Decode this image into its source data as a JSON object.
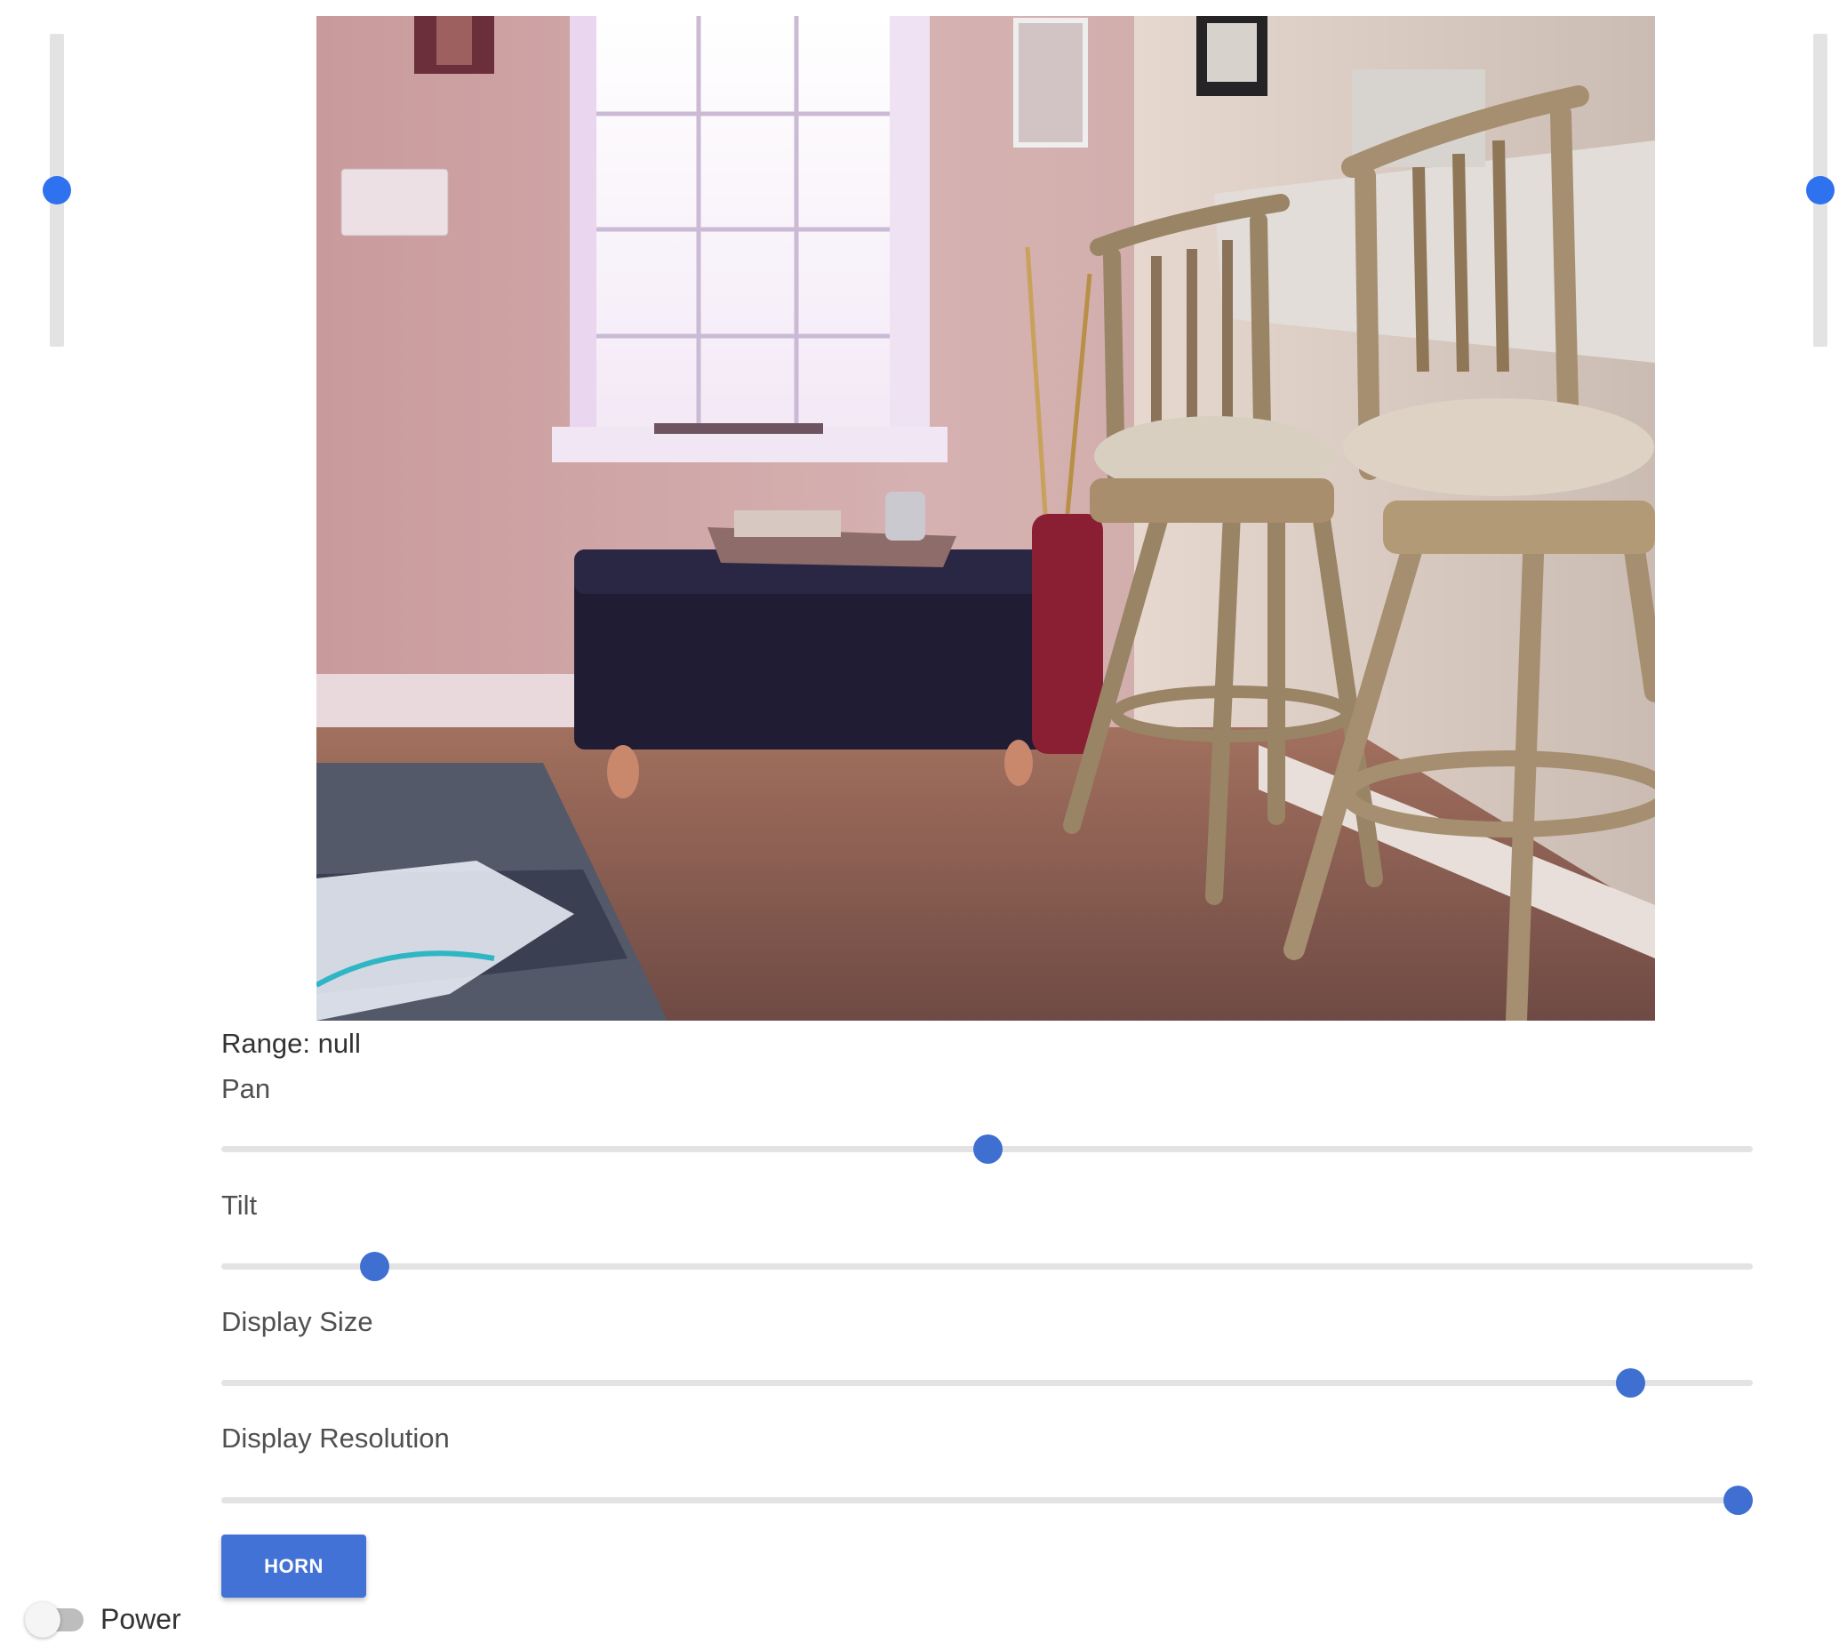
{
  "motors": {
    "left_level": 0.5,
    "right_level": 0.5
  },
  "camera": {
    "description_icon": "camera-feed"
  },
  "range": {
    "text": "Range: null"
  },
  "controls": {
    "pan": {
      "label": "Pan",
      "value_fraction": 0.5
    },
    "tilt": {
      "label": "Tilt",
      "value_fraction": 0.1
    },
    "display_size": {
      "label": "Display Size",
      "value_fraction": 0.92
    },
    "display_resolution": {
      "label": "Display Resolution",
      "value_fraction": 0.99
    }
  },
  "horn": {
    "label": "HORN"
  },
  "power": {
    "label": "Power",
    "on": false
  },
  "colors": {
    "accent": "#3f6fd1",
    "motor_thumb": "#2f72ef",
    "track": "#e3e3e3"
  }
}
